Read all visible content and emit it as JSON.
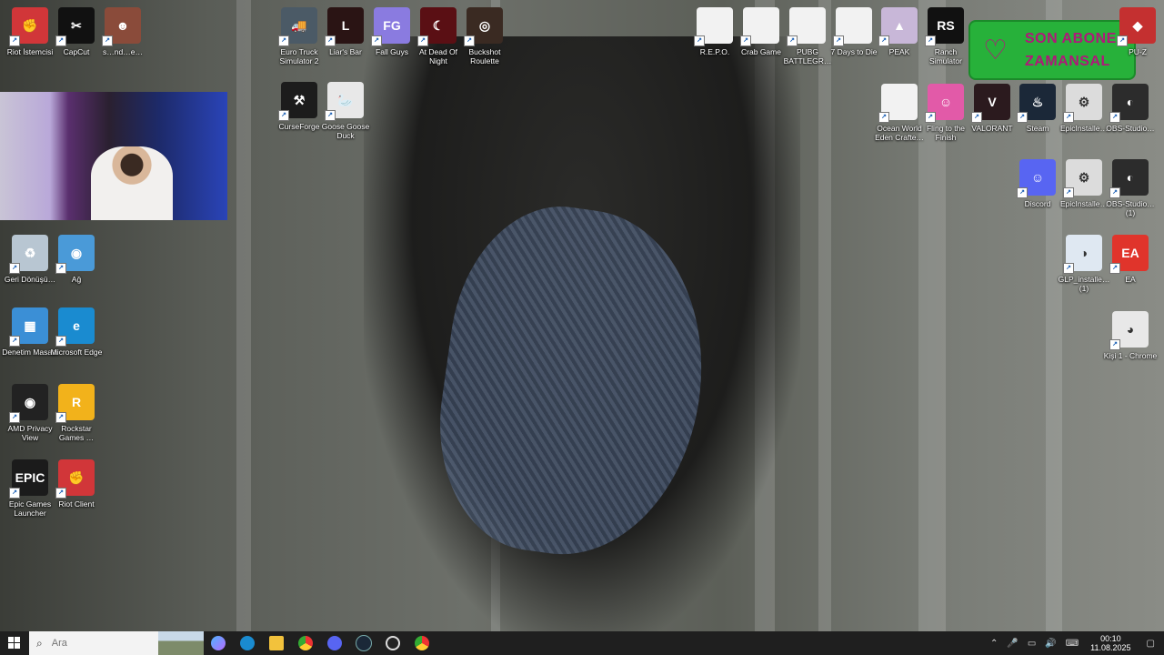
{
  "desktop": {
    "left_icons": [
      {
        "name": "riot-icon",
        "label": "Riot İstemcisi",
        "color": "#d13639",
        "glyph": "✊"
      },
      {
        "name": "capcut-icon",
        "label": "CapCut",
        "color": "#111111",
        "glyph": "✂"
      },
      {
        "name": "shortcut-icon",
        "label": "s…nd…e…",
        "color": "#8a4b3a",
        "glyph": "☻"
      },
      {
        "name": "recycle-bin-icon",
        "label": "Geri Dönüşü…",
        "color": "#b8c6d2",
        "glyph": "♻"
      },
      {
        "name": "network-icon",
        "label": "Ağ",
        "color": "#4a9ad8",
        "glyph": "◉"
      },
      {
        "name": "control-panel-icon",
        "label": "Denetim Masası",
        "color": "#3b8fd6",
        "glyph": "▦"
      },
      {
        "name": "edge-icon",
        "label": "Microsoft Edge",
        "color": "#1a8bd0",
        "glyph": "e"
      },
      {
        "name": "amd-privacy-icon",
        "label": "AMD Privacy View",
        "color": "#222222",
        "glyph": "◉"
      },
      {
        "name": "rockstar-icon",
        "label": "Rockstar Games …",
        "color": "#f2b21b",
        "glyph": "R"
      },
      {
        "name": "epic-icon",
        "label": "Epic Games Launcher",
        "color": "#1b1b1b",
        "glyph": "EPIC"
      },
      {
        "name": "riot-client-icon",
        "label": "Riot Client",
        "color": "#d13639",
        "glyph": "✊"
      }
    ],
    "top_icons": [
      {
        "name": "euro-truck-icon",
        "label": "Euro Truck Simulator 2",
        "color": "#4b5a66",
        "glyph": "🚚"
      },
      {
        "name": "liars-bar-icon",
        "label": "Liar's Bar",
        "color": "#2a1414",
        "glyph": "L"
      },
      {
        "name": "fall-guys-icon",
        "label": "Fall Guys",
        "color": "#8a7be0",
        "glyph": "FG"
      },
      {
        "name": "at-dead-of-night-icon",
        "label": "At Dead Of Night",
        "color": "#5a0f14",
        "glyph": "☾"
      },
      {
        "name": "buckshot-roulette-icon",
        "label": "Buckshot Roulette",
        "color": "#3a2a22",
        "glyph": "◎"
      },
      {
        "name": "curseforge-icon",
        "label": "CurseForge",
        "color": "#1c1c1c",
        "glyph": "⚒"
      },
      {
        "name": "goose-goose-duck-icon",
        "label": "Goose Goose Duck",
        "color": "#e8e8e8",
        "glyph": "🦢"
      }
    ],
    "right_icons": [
      {
        "name": "repo-file-icon",
        "label": "R.E.P.O.",
        "color": "#f2f2f2",
        "glyph": ""
      },
      {
        "name": "crab-game-file-icon",
        "label": "Crab Game",
        "color": "#f2f2f2",
        "glyph": ""
      },
      {
        "name": "pubg-file-icon",
        "label": "PUBG BATTLEGR…",
        "color": "#f2f2f2",
        "glyph": ""
      },
      {
        "name": "7-days-file-icon",
        "label": "7 Days to Die",
        "color": "#f2f2f2",
        "glyph": ""
      },
      {
        "name": "peak-icon",
        "label": "PEAK",
        "color": "#c8b7d8",
        "glyph": "▲"
      },
      {
        "name": "ranch-simulator-icon",
        "label": "Ranch Simulator",
        "color": "#111111",
        "glyph": "RS"
      },
      {
        "name": "pubg-z-icon",
        "label": "PU-Z",
        "color": "#c43030",
        "glyph": "◆"
      },
      {
        "name": "ocean-world-file-icon",
        "label": "Ocean World Eden Crafte…",
        "color": "#f2f2f2",
        "glyph": ""
      },
      {
        "name": "fling-to-finish-icon",
        "label": "Fling to the Finish",
        "color": "#e25aa8",
        "glyph": "☺"
      },
      {
        "name": "valorant-icon",
        "label": "VALORANT",
        "color": "#2b1a1e",
        "glyph": "V"
      },
      {
        "name": "steam-icon",
        "label": "Steam",
        "color": "#1b2838",
        "glyph": "♨"
      },
      {
        "name": "epic-installer-icon",
        "label": "EpicInstalle…",
        "color": "#dcdcdc",
        "glyph": "⚙"
      },
      {
        "name": "obs-studio-icon",
        "label": "OBS-Studio…",
        "color": "#2c2c2c",
        "glyph": "◐"
      },
      {
        "name": "discord-icon",
        "label": "Discord",
        "color": "#5865f2",
        "glyph": "☺"
      },
      {
        "name": "epic-installer-2-icon",
        "label": "EpicInstalle…",
        "color": "#dcdcdc",
        "glyph": "⚙"
      },
      {
        "name": "obs-studio-1-icon",
        "label": "OBS-Studio… (1)",
        "color": "#2c2c2c",
        "glyph": "◐"
      },
      {
        "name": "glp-installer-icon",
        "label": "GLP_installe… (1)",
        "color": "#dfe8f2",
        "glyph": "◑"
      },
      {
        "name": "ea-icon",
        "label": "EA",
        "color": "#e0342b",
        "glyph": "EA"
      },
      {
        "name": "chrome-profile-icon",
        "label": "Kişi 1 - Chrome",
        "color": "#e8e8e8",
        "glyph": "◕"
      }
    ]
  },
  "overlay": {
    "subscriber_line1": "SON ABONE",
    "subscriber_line2": "ZAMANSAL"
  },
  "taskbar": {
    "search_placeholder": "Ara",
    "time": "00:10",
    "date": "11.08.2025"
  }
}
